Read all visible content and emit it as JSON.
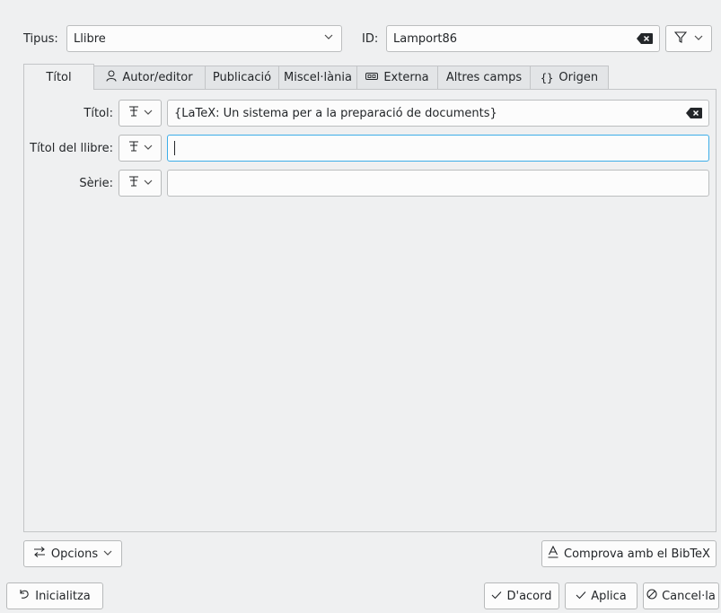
{
  "header": {
    "type_label": "Tipus:",
    "type_value": "Llibre",
    "id_label": "ID:",
    "id_value": "Lamport86"
  },
  "tabs": [
    {
      "label": "Títol",
      "icon": ""
    },
    {
      "label": "Autor/editor",
      "icon": "person-icon"
    },
    {
      "label": "Publicació",
      "icon": ""
    },
    {
      "label": "Miscel·lània",
      "icon": ""
    },
    {
      "label": "Externa",
      "icon": "link-icon"
    },
    {
      "label": "Altres camps",
      "icon": ""
    },
    {
      "label": "Origen",
      "icon": "braces-icon"
    }
  ],
  "fields": [
    {
      "label": "Títol:",
      "value": "{LaTeX: Un sistema per a la preparació de documents}"
    },
    {
      "label": "Títol del llibre:",
      "value": ""
    },
    {
      "label": "Sèrie:",
      "value": ""
    }
  ],
  "buttons": {
    "options": "Opcions",
    "check_bibtex": "Comprova amb el BibTeX",
    "reset": "Inicialitza",
    "ok": "D'acord",
    "apply": "Aplica",
    "cancel": "Cancel·la"
  }
}
